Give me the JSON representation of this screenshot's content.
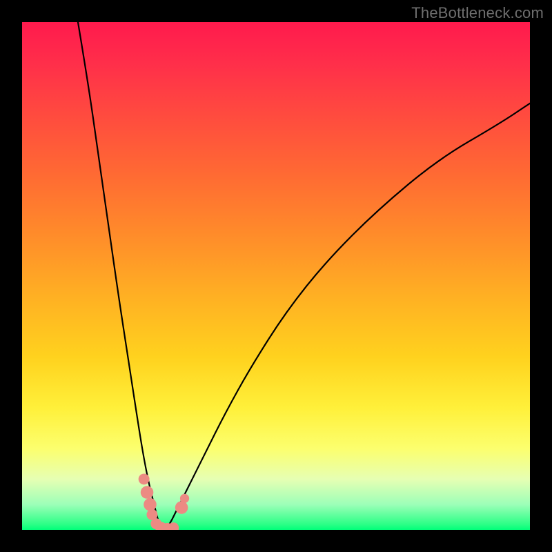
{
  "watermark": "TheBottleneck.com",
  "colors": {
    "frame": "#000000",
    "marker": "#ec8a83",
    "curve": "#000000"
  },
  "chart_data": {
    "type": "line",
    "title": "",
    "xlabel": "",
    "ylabel": "",
    "xlim": [
      0,
      100
    ],
    "ylim": [
      0,
      100
    ],
    "grid": false,
    "legend": false,
    "note": "Unlabeled bottleneck-style V-shaped curve over red→green vertical gradient; minimum (best match) occurs near x≈27 where y≈0. Values estimated from pixel positions.",
    "series": [
      {
        "name": "left-branch",
        "x": [
          11,
          13,
          15,
          17,
          19,
          21,
          23,
          24,
          25,
          26,
          27,
          28
        ],
        "y": [
          100,
          88,
          74,
          60,
          46,
          33,
          20,
          14,
          9,
          5,
          1,
          0
        ]
      },
      {
        "name": "right-branch",
        "x": [
          28,
          29,
          30,
          31,
          33,
          36,
          40,
          45,
          52,
          60,
          70,
          82,
          94,
          100
        ],
        "y": [
          0,
          1,
          3,
          5,
          9,
          15,
          23,
          32,
          43,
          53,
          63,
          73,
          80,
          84
        ]
      }
    ],
    "markers": [
      {
        "x": 24.0,
        "y": 10.0,
        "r": 1.2
      },
      {
        "x": 24.6,
        "y": 7.4,
        "r": 1.4
      },
      {
        "x": 25.2,
        "y": 5.0,
        "r": 1.4
      },
      {
        "x": 25.6,
        "y": 3.0,
        "r": 1.2
      },
      {
        "x": 26.4,
        "y": 1.2,
        "r": 1.2
      },
      {
        "x": 27.4,
        "y": 0.4,
        "r": 1.3
      },
      {
        "x": 28.6,
        "y": 0.2,
        "r": 1.3
      },
      {
        "x": 29.8,
        "y": 0.4,
        "r": 1.2
      },
      {
        "x": 31.4,
        "y": 4.4,
        "r": 1.4
      },
      {
        "x": 32.0,
        "y": 6.2,
        "r": 1.0
      }
    ]
  }
}
